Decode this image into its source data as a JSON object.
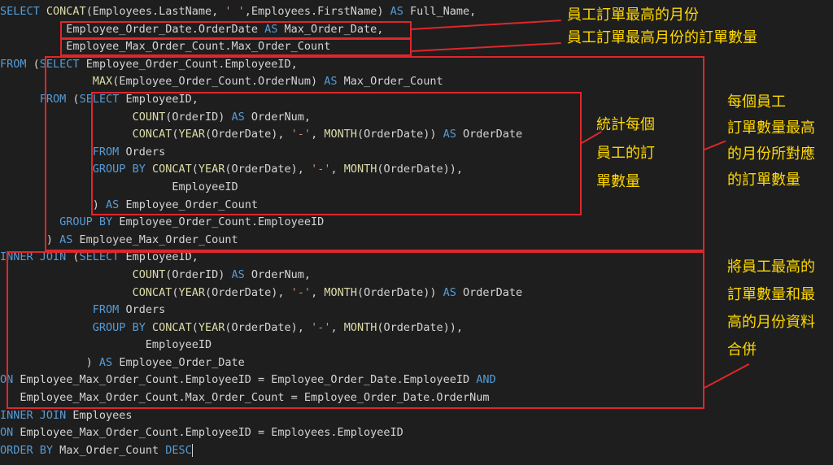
{
  "code_lines": [
    [
      [
        "kw",
        "SELECT "
      ],
      [
        "fn",
        "CONCAT"
      ],
      [
        "id",
        "(Employees.LastName, "
      ],
      [
        "str",
        "' '"
      ],
      [
        "id",
        ",Employees.FirstName) "
      ],
      [
        "kw",
        "AS "
      ],
      [
        "id",
        "Full_Name,"
      ]
    ],
    [
      [
        "id",
        "          Employee_Order_Date.OrderDate "
      ],
      [
        "kw",
        "AS "
      ],
      [
        "id",
        "Max_Order_Date,"
      ]
    ],
    [
      [
        "id",
        "          Employee_Max_Order_Count.Max_Order_Count"
      ]
    ],
    [
      [
        "kw",
        "FROM "
      ],
      [
        "id",
        "("
      ],
      [
        "kw",
        "SELECT "
      ],
      [
        "id",
        "Employee_Order_Count.EmployeeID,"
      ]
    ],
    [
      [
        "id",
        "              "
      ],
      [
        "fn",
        "MAX"
      ],
      [
        "id",
        "(Employee_Order_Count.OrderNum) "
      ],
      [
        "kw",
        "AS "
      ],
      [
        "id",
        "Max_Order_Count"
      ]
    ],
    [
      [
        "id",
        "      "
      ],
      [
        "kw",
        "FROM "
      ],
      [
        "id",
        "("
      ],
      [
        "kw",
        "SELECT "
      ],
      [
        "id",
        "EmployeeID,"
      ]
    ],
    [
      [
        "id",
        "                    "
      ],
      [
        "fn",
        "COUNT"
      ],
      [
        "id",
        "(OrderID) "
      ],
      [
        "kw",
        "AS "
      ],
      [
        "id",
        "OrderNum,"
      ]
    ],
    [
      [
        "id",
        "                    "
      ],
      [
        "fn",
        "CONCAT"
      ],
      [
        "id",
        "("
      ],
      [
        "fn",
        "YEAR"
      ],
      [
        "id",
        "(OrderDate), "
      ],
      [
        "str",
        "'-'"
      ],
      [
        "id",
        ", "
      ],
      [
        "fn",
        "MONTH"
      ],
      [
        "id",
        "(OrderDate)) "
      ],
      [
        "kw",
        "AS "
      ],
      [
        "id",
        "OrderDate"
      ]
    ],
    [
      [
        "id",
        "              "
      ],
      [
        "kw",
        "FROM "
      ],
      [
        "id",
        "Orders"
      ]
    ],
    [
      [
        "id",
        "              "
      ],
      [
        "kw",
        "GROUP BY "
      ],
      [
        "fn",
        "CONCAT"
      ],
      [
        "id",
        "("
      ],
      [
        "fn",
        "YEAR"
      ],
      [
        "id",
        "(OrderDate), "
      ],
      [
        "str",
        "'-'"
      ],
      [
        "id",
        ", "
      ],
      [
        "fn",
        "MONTH"
      ],
      [
        "id",
        "(OrderDate)),"
      ]
    ],
    [
      [
        "id",
        "                          EmployeeID"
      ]
    ],
    [
      [
        "id",
        "              ) "
      ],
      [
        "kw",
        "AS "
      ],
      [
        "id",
        "Employee_Order_Count"
      ]
    ],
    [
      [
        "id",
        "         "
      ],
      [
        "kw",
        "GROUP BY "
      ],
      [
        "id",
        "Employee_Order_Count.EmployeeID"
      ]
    ],
    [
      [
        "id",
        "       ) "
      ],
      [
        "kw",
        "AS "
      ],
      [
        "id",
        "Employee_Max_Order_Count"
      ]
    ],
    [
      [
        "kw",
        "INNER JOIN "
      ],
      [
        "id",
        "("
      ],
      [
        "kw",
        "SELECT "
      ],
      [
        "id",
        "EmployeeID,"
      ]
    ],
    [
      [
        "id",
        "                    "
      ],
      [
        "fn",
        "COUNT"
      ],
      [
        "id",
        "(OrderID) "
      ],
      [
        "kw",
        "AS "
      ],
      [
        "id",
        "OrderNum,"
      ]
    ],
    [
      [
        "id",
        "                    "
      ],
      [
        "fn",
        "CONCAT"
      ],
      [
        "id",
        "("
      ],
      [
        "fn",
        "YEAR"
      ],
      [
        "id",
        "(OrderDate), "
      ],
      [
        "str",
        "'-'"
      ],
      [
        "id",
        ", "
      ],
      [
        "fn",
        "MONTH"
      ],
      [
        "id",
        "(OrderDate)) "
      ],
      [
        "kw",
        "AS "
      ],
      [
        "id",
        "OrderDate"
      ]
    ],
    [
      [
        "id",
        "              "
      ],
      [
        "kw",
        "FROM "
      ],
      [
        "id",
        "Orders"
      ]
    ],
    [
      [
        "id",
        "              "
      ],
      [
        "kw",
        "GROUP BY "
      ],
      [
        "fn",
        "CONCAT"
      ],
      [
        "id",
        "("
      ],
      [
        "fn",
        "YEAR"
      ],
      [
        "id",
        "(OrderDate), "
      ],
      [
        "str",
        "'-'"
      ],
      [
        "id",
        ", "
      ],
      [
        "fn",
        "MONTH"
      ],
      [
        "id",
        "(OrderDate)),"
      ]
    ],
    [
      [
        "id",
        "                      EmployeeID"
      ]
    ],
    [
      [
        "id",
        "             ) "
      ],
      [
        "kw",
        "AS "
      ],
      [
        "id",
        "Employee_Order_Date"
      ]
    ],
    [
      [
        "kw",
        "ON "
      ],
      [
        "id",
        "Employee_Max_Order_Count.EmployeeID = Employee_Order_Date.EmployeeID "
      ],
      [
        "kw",
        "AND"
      ]
    ],
    [
      [
        "id",
        "   Employee_Max_Order_Count.Max_Order_Count = Employee_Order_Date.OrderNum"
      ]
    ],
    [
      [
        "kw",
        "INNER JOIN "
      ],
      [
        "id",
        "Employees"
      ]
    ],
    [
      [
        "kw",
        "ON "
      ],
      [
        "id",
        "Employee_Max_Order_Count.EmployeeID = Employees.EmployeeID"
      ]
    ],
    [
      [
        "kw",
        "ORDER BY "
      ],
      [
        "id",
        "Max_Order_Count "
      ],
      [
        "kw",
        "DESC"
      ]
    ]
  ],
  "annotations": {
    "max_month": "員工訂單最高的月份",
    "max_month_count": "員工訂單最高月份的訂單數量",
    "count_per_employee": "統計每個\n員工的訂\n單數量",
    "max_count_per_month": "每個員工\n訂單數量最高\n的月份所對應\n的訂單數量",
    "join_note": "將員工最高的\n訂單數量和最\n高的月份資料\n合併"
  },
  "colors": {
    "background": "#1e1e1e",
    "keyword": "#569cd6",
    "function": "#dcdcaa",
    "identifier": "#d4d4d4",
    "string": "#ce9178",
    "highlight_box": "#e0262b",
    "note_text": "#ffd800"
  }
}
